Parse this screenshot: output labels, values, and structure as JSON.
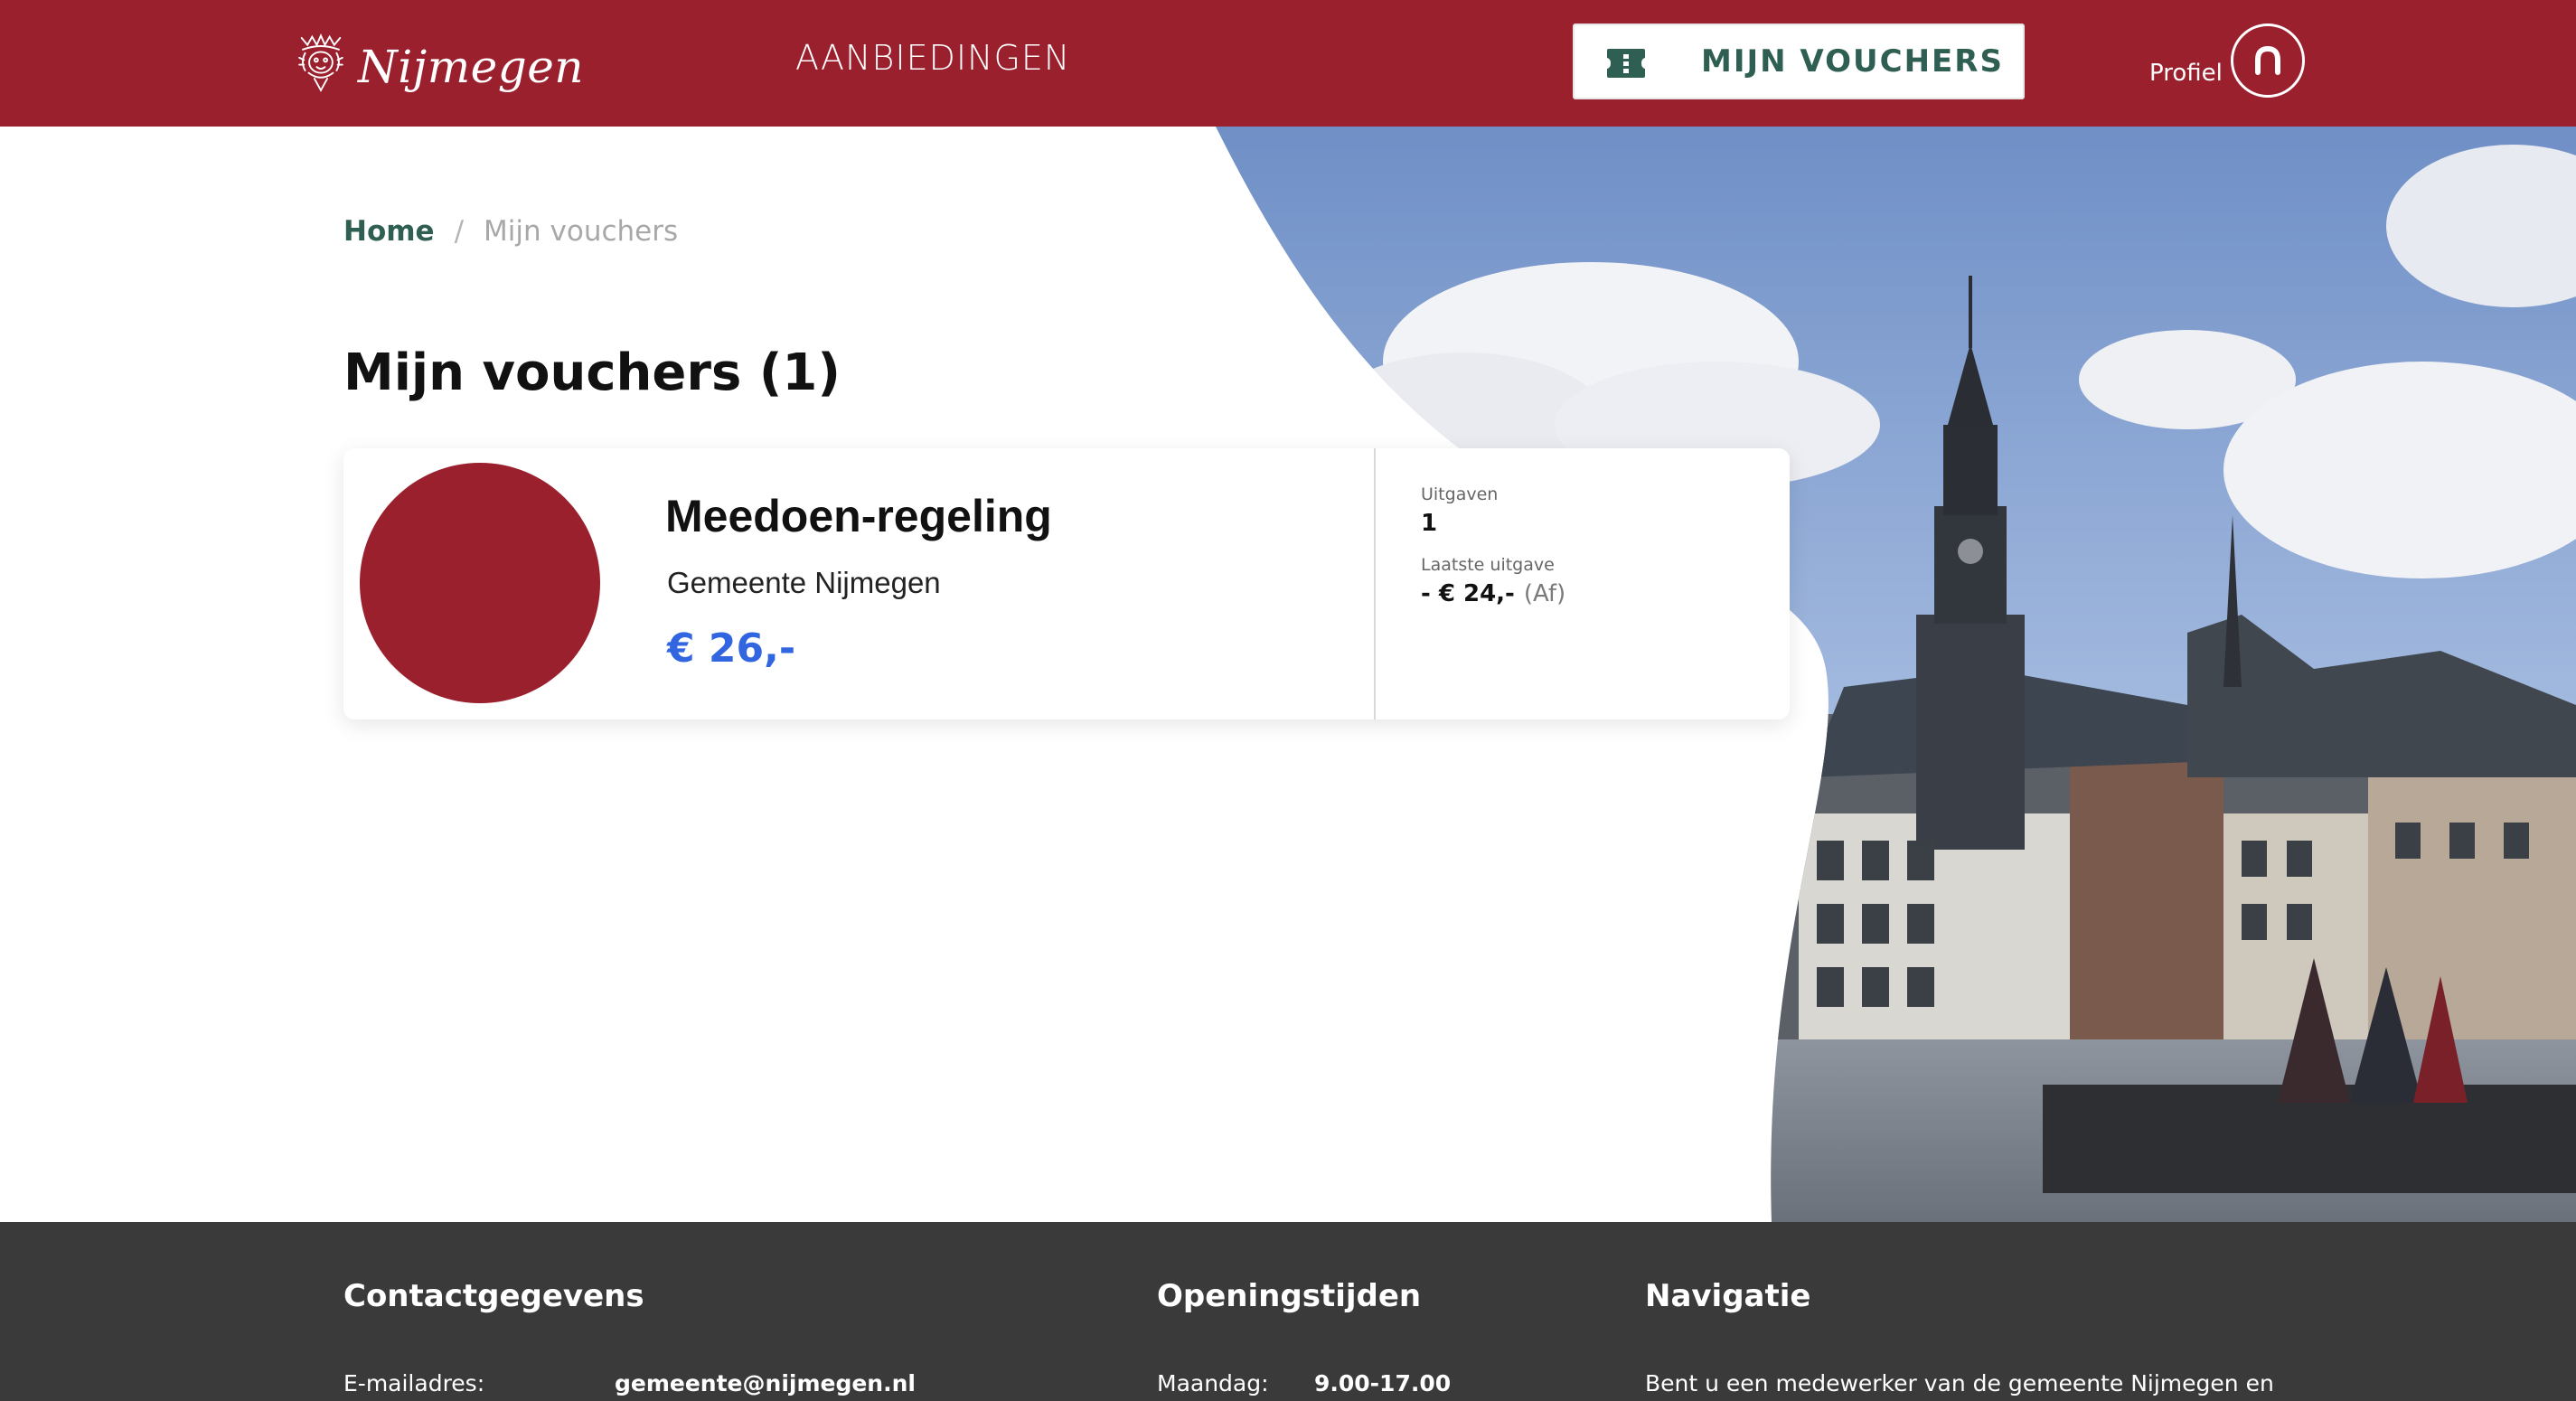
{
  "header": {
    "brand": "Nijmegen",
    "nav_offers": "AANBIEDINGEN",
    "vouchers_button": "MIJN VOUCHERS",
    "profile_label": "Profiel"
  },
  "breadcrumb": {
    "home": "Home",
    "separator": "/",
    "current": "Mijn vouchers"
  },
  "page_title": "Mijn vouchers (1)",
  "voucher": {
    "title": "Meedoen-regeling",
    "organization": "Gemeente Nijmegen",
    "amount": "€ 26,-",
    "spent_label": "Uitgaven",
    "spent_value": "1",
    "last_label": "Laatste uitgave",
    "last_value": "- € 24,-",
    "last_status": "(Af)"
  },
  "footer": {
    "contact_heading": "Contactgegevens",
    "email_label": "E-mailadres:",
    "email_value": "gemeente@nijmegen.nl",
    "hours_heading": "Openingstijden",
    "day_label": "Maandag:",
    "day_value": "9.00-17.00",
    "nav_heading": "Navigatie",
    "nav_text": "Bent u een medewerker van de gemeente Nijmegen en"
  },
  "colors": {
    "brand_red": "#9b202e",
    "accent_green": "#2f5f52",
    "amount_blue": "#3166e0",
    "footer_bg": "#3a3a3a"
  },
  "icons": {
    "logo": "lion-crest-logo",
    "vouchers": "ticket-icon",
    "profile": "user-icon"
  }
}
